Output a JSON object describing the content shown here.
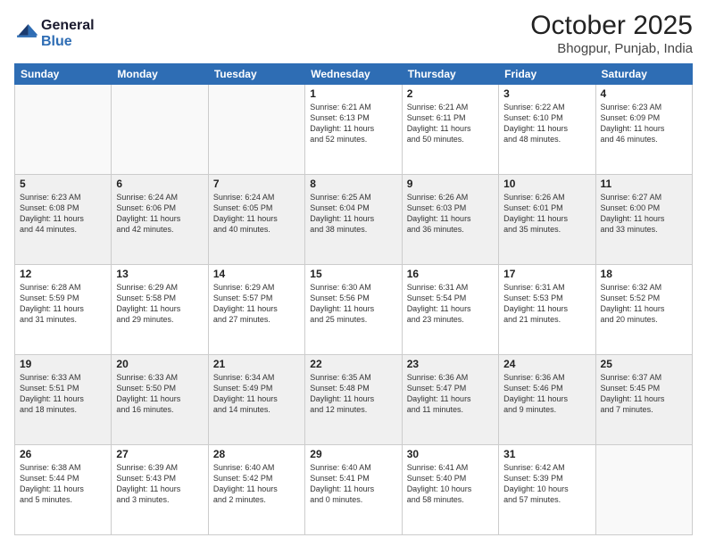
{
  "header": {
    "logo_line1": "General",
    "logo_line2": "Blue",
    "month_title": "October 2025",
    "location": "Bhogpur, Punjab, India"
  },
  "weekdays": [
    "Sunday",
    "Monday",
    "Tuesday",
    "Wednesday",
    "Thursday",
    "Friday",
    "Saturday"
  ],
  "weeks": [
    [
      {
        "day": "",
        "info": ""
      },
      {
        "day": "",
        "info": ""
      },
      {
        "day": "",
        "info": ""
      },
      {
        "day": "1",
        "info": "Sunrise: 6:21 AM\nSunset: 6:13 PM\nDaylight: 11 hours\nand 52 minutes."
      },
      {
        "day": "2",
        "info": "Sunrise: 6:21 AM\nSunset: 6:11 PM\nDaylight: 11 hours\nand 50 minutes."
      },
      {
        "day": "3",
        "info": "Sunrise: 6:22 AM\nSunset: 6:10 PM\nDaylight: 11 hours\nand 48 minutes."
      },
      {
        "day": "4",
        "info": "Sunrise: 6:23 AM\nSunset: 6:09 PM\nDaylight: 11 hours\nand 46 minutes."
      }
    ],
    [
      {
        "day": "5",
        "info": "Sunrise: 6:23 AM\nSunset: 6:08 PM\nDaylight: 11 hours\nand 44 minutes."
      },
      {
        "day": "6",
        "info": "Sunrise: 6:24 AM\nSunset: 6:06 PM\nDaylight: 11 hours\nand 42 minutes."
      },
      {
        "day": "7",
        "info": "Sunrise: 6:24 AM\nSunset: 6:05 PM\nDaylight: 11 hours\nand 40 minutes."
      },
      {
        "day": "8",
        "info": "Sunrise: 6:25 AM\nSunset: 6:04 PM\nDaylight: 11 hours\nand 38 minutes."
      },
      {
        "day": "9",
        "info": "Sunrise: 6:26 AM\nSunset: 6:03 PM\nDaylight: 11 hours\nand 36 minutes."
      },
      {
        "day": "10",
        "info": "Sunrise: 6:26 AM\nSunset: 6:01 PM\nDaylight: 11 hours\nand 35 minutes."
      },
      {
        "day": "11",
        "info": "Sunrise: 6:27 AM\nSunset: 6:00 PM\nDaylight: 11 hours\nand 33 minutes."
      }
    ],
    [
      {
        "day": "12",
        "info": "Sunrise: 6:28 AM\nSunset: 5:59 PM\nDaylight: 11 hours\nand 31 minutes."
      },
      {
        "day": "13",
        "info": "Sunrise: 6:29 AM\nSunset: 5:58 PM\nDaylight: 11 hours\nand 29 minutes."
      },
      {
        "day": "14",
        "info": "Sunrise: 6:29 AM\nSunset: 5:57 PM\nDaylight: 11 hours\nand 27 minutes."
      },
      {
        "day": "15",
        "info": "Sunrise: 6:30 AM\nSunset: 5:56 PM\nDaylight: 11 hours\nand 25 minutes."
      },
      {
        "day": "16",
        "info": "Sunrise: 6:31 AM\nSunset: 5:54 PM\nDaylight: 11 hours\nand 23 minutes."
      },
      {
        "day": "17",
        "info": "Sunrise: 6:31 AM\nSunset: 5:53 PM\nDaylight: 11 hours\nand 21 minutes."
      },
      {
        "day": "18",
        "info": "Sunrise: 6:32 AM\nSunset: 5:52 PM\nDaylight: 11 hours\nand 20 minutes."
      }
    ],
    [
      {
        "day": "19",
        "info": "Sunrise: 6:33 AM\nSunset: 5:51 PM\nDaylight: 11 hours\nand 18 minutes."
      },
      {
        "day": "20",
        "info": "Sunrise: 6:33 AM\nSunset: 5:50 PM\nDaylight: 11 hours\nand 16 minutes."
      },
      {
        "day": "21",
        "info": "Sunrise: 6:34 AM\nSunset: 5:49 PM\nDaylight: 11 hours\nand 14 minutes."
      },
      {
        "day": "22",
        "info": "Sunrise: 6:35 AM\nSunset: 5:48 PM\nDaylight: 11 hours\nand 12 minutes."
      },
      {
        "day": "23",
        "info": "Sunrise: 6:36 AM\nSunset: 5:47 PM\nDaylight: 11 hours\nand 11 minutes."
      },
      {
        "day": "24",
        "info": "Sunrise: 6:36 AM\nSunset: 5:46 PM\nDaylight: 11 hours\nand 9 minutes."
      },
      {
        "day": "25",
        "info": "Sunrise: 6:37 AM\nSunset: 5:45 PM\nDaylight: 11 hours\nand 7 minutes."
      }
    ],
    [
      {
        "day": "26",
        "info": "Sunrise: 6:38 AM\nSunset: 5:44 PM\nDaylight: 11 hours\nand 5 minutes."
      },
      {
        "day": "27",
        "info": "Sunrise: 6:39 AM\nSunset: 5:43 PM\nDaylight: 11 hours\nand 3 minutes."
      },
      {
        "day": "28",
        "info": "Sunrise: 6:40 AM\nSunset: 5:42 PM\nDaylight: 11 hours\nand 2 minutes."
      },
      {
        "day": "29",
        "info": "Sunrise: 6:40 AM\nSunset: 5:41 PM\nDaylight: 11 hours\nand 0 minutes."
      },
      {
        "day": "30",
        "info": "Sunrise: 6:41 AM\nSunset: 5:40 PM\nDaylight: 10 hours\nand 58 minutes."
      },
      {
        "day": "31",
        "info": "Sunrise: 6:42 AM\nSunset: 5:39 PM\nDaylight: 10 hours\nand 57 minutes."
      },
      {
        "day": "",
        "info": ""
      }
    ]
  ],
  "row_styles": [
    "row-white",
    "row-shaded",
    "row-white",
    "row-shaded",
    "row-white"
  ]
}
